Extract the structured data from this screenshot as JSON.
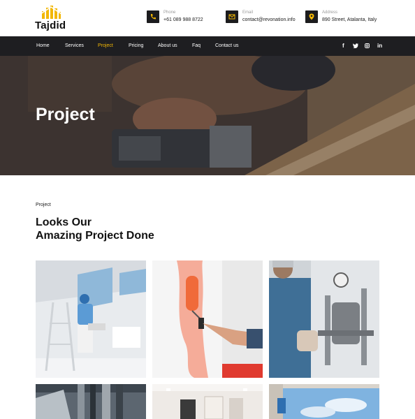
{
  "brand": {
    "name": "Tajdid"
  },
  "contacts": [
    {
      "icon": "phone-icon",
      "label": "Phone",
      "value": "+61 089 988 8722"
    },
    {
      "icon": "email-icon",
      "label": "Email",
      "value": "contact@revonation.info"
    },
    {
      "icon": "location-icon",
      "label": "Address",
      "value": "890 Street, Atalanta, Italy"
    }
  ],
  "nav": {
    "items": [
      "Home",
      "Services",
      "Project",
      "Pricing",
      "About us",
      "Faq",
      "Contact us"
    ],
    "active": "Project"
  },
  "social": [
    "facebook-icon",
    "twitter-icon",
    "instagram-icon",
    "linkedin-icon"
  ],
  "hero": {
    "title": "Project"
  },
  "section": {
    "label": "Project",
    "title_line1": "Looks Our",
    "title_line2": "Amazing Project Done"
  },
  "gallery": {
    "tiles": [
      "painter-on-ladder",
      "paint-roller-wall",
      "plumber-pipes",
      "pipes-ceiling",
      "room-interior",
      "window-cleaning"
    ]
  },
  "colors": {
    "accent": "#f2b705",
    "dark": "#1e1e21"
  }
}
